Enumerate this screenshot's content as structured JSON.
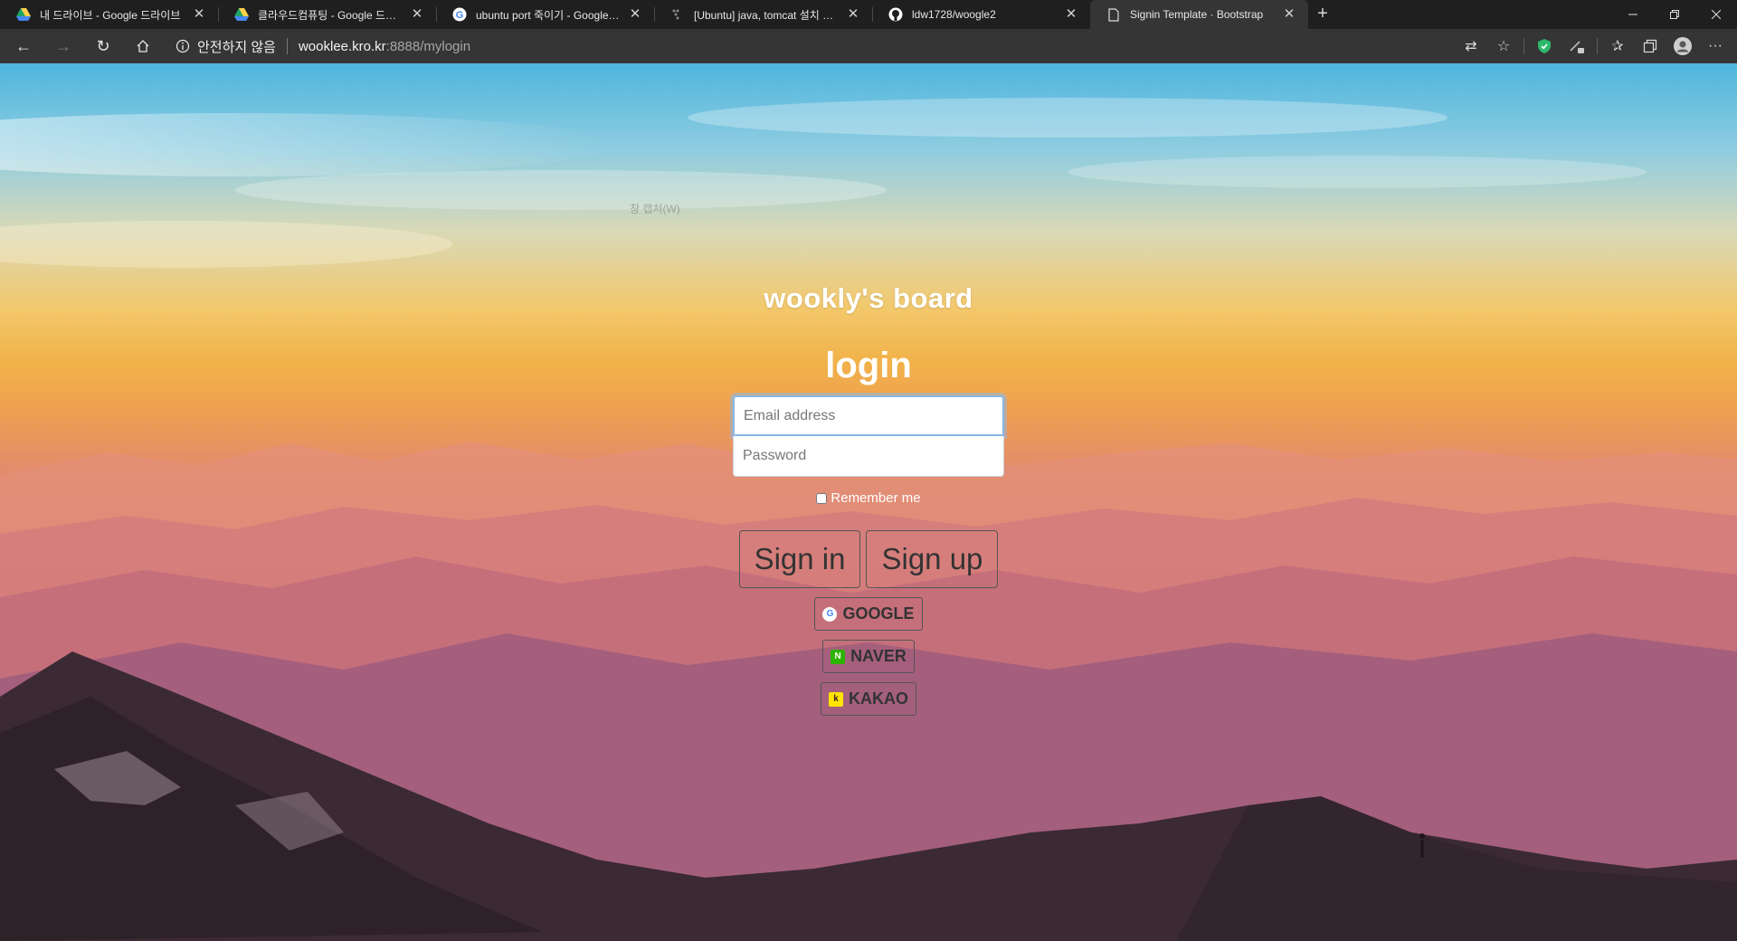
{
  "tabs": [
    {
      "title": "내 드라이브 - Google 드라이브",
      "icon": "google-drive-icon",
      "active": false
    },
    {
      "title": "클라우드컴퓨팅 - Google 드라이브",
      "icon": "google-drive-icon",
      "active": false
    },
    {
      "title": "ubuntu port 죽이기 - Google 검색",
      "icon": "google-icon",
      "active": false
    },
    {
      "title": "[Ubuntu] java, tomcat 설치 및 환경",
      "icon": "blog-icon",
      "active": false
    },
    {
      "title": "ldw1728/woogle2",
      "icon": "github-icon",
      "active": false
    },
    {
      "title": "Signin Template · Bootstrap",
      "icon": "page-icon",
      "active": true
    }
  ],
  "toolbar": {
    "security_label": "안전하지 않음",
    "url_host": "wooklee.kro.kr",
    "url_path": ":8888/mylogin"
  },
  "page": {
    "faint_text": "창 캡처(W)",
    "brand": "wookly's board",
    "heading": "login",
    "email_placeholder": "Email address",
    "password_placeholder": "Password",
    "remember_label": "Remember me",
    "signin_label": "Sign in",
    "signup_label": "Sign up",
    "google_label": "GOOGLE",
    "naver_label": "NAVER",
    "kakao_label": "KAKAO",
    "google_badge": "G",
    "naver_badge": "N",
    "kakao_badge": "k"
  },
  "colors": {
    "accent_secure": "#2db86b",
    "naver": "#2db400",
    "kakao": "#fee500"
  }
}
